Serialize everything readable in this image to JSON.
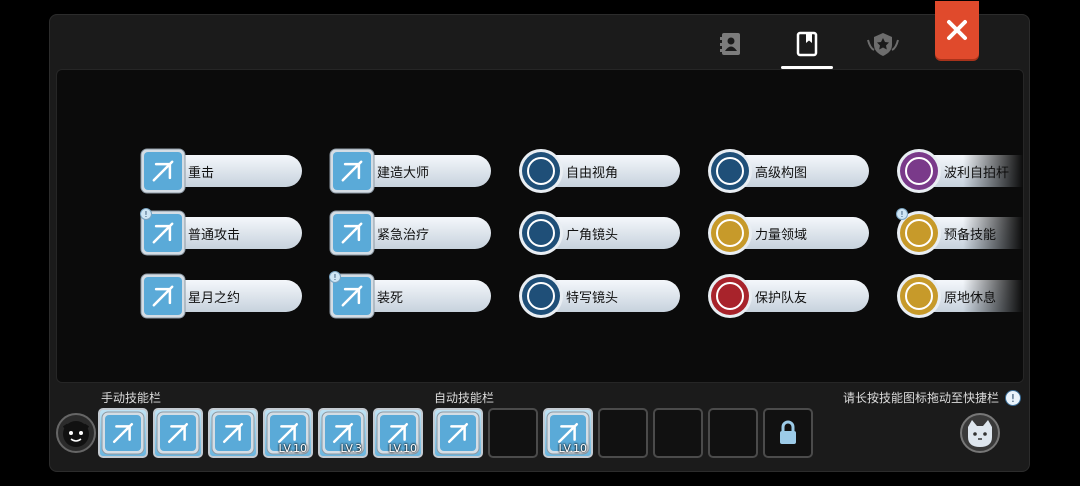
{
  "tabs": [
    {
      "icon": "contact-book-icon",
      "active": false
    },
    {
      "icon": "bookmark-book-icon",
      "active": true
    },
    {
      "icon": "star-badge-icon",
      "active": false
    }
  ],
  "close_icon": "close-icon",
  "skills": [
    {
      "label": "重击",
      "icon": "fist-icon",
      "style": "blue"
    },
    {
      "label": "建造大师",
      "icon": "house-build-icon",
      "style": "blue"
    },
    {
      "label": "自由视角",
      "icon": "eye-360-icon",
      "style": "dark-blue"
    },
    {
      "label": "高级构图",
      "icon": "camera-frame-icon",
      "style": "dark-blue"
    },
    {
      "label": "波利自拍杆",
      "icon": "selfie-stick-icon",
      "style": "purple"
    },
    {
      "label": "普通攻击",
      "icon": "sword-attack-icon",
      "style": "blue",
      "badge": "!"
    },
    {
      "label": "紧急治疗",
      "icon": "heal-icon",
      "style": "blue"
    },
    {
      "label": "广角镜头",
      "icon": "wide-lens-icon",
      "style": "dark-blue"
    },
    {
      "label": "力量领域",
      "icon": "power-field-icon",
      "style": "gold"
    },
    {
      "label": "预备技能",
      "icon": "ready-skill-icon",
      "style": "gold",
      "badge": "!"
    },
    {
      "label": "星月之约",
      "icon": "star-moon-icon",
      "style": "blue"
    },
    {
      "label": "装死",
      "icon": "play-dead-icon",
      "style": "blue",
      "badge": "!"
    },
    {
      "label": "特写镜头",
      "icon": "closeup-lens-icon",
      "style": "dark-blue"
    },
    {
      "label": "保护队友",
      "icon": "protect-ally-icon",
      "style": "red"
    },
    {
      "label": "原地休息",
      "icon": "rest-icon",
      "style": "gold"
    }
  ],
  "manual_bar": {
    "label": "手动技能栏",
    "slots": [
      {
        "icon": "sword-attack-icon",
        "level": ""
      },
      {
        "icon": "fist-icon",
        "level": ""
      },
      {
        "icon": "play-dead-icon",
        "level": ""
      },
      {
        "icon": "whirl-skill-icon",
        "level": "LV.10"
      },
      {
        "icon": "wave-skill-icon",
        "level": "LV.3"
      },
      {
        "icon": "lightning-skill-icon",
        "level": "LV.10"
      }
    ]
  },
  "auto_bar": {
    "label": "自动技能栏",
    "slots": [
      {
        "icon": "sword-attack-icon",
        "level": "",
        "filled": true
      },
      {
        "icon": "",
        "level": "",
        "filled": false
      },
      {
        "icon": "whirl-skill-icon",
        "level": "LV.10",
        "filled": true
      },
      {
        "icon": "",
        "level": "",
        "filled": false
      },
      {
        "icon": "",
        "level": "",
        "filled": false
      },
      {
        "icon": "",
        "level": "",
        "filled": false
      },
      {
        "icon": "lock-icon",
        "level": "",
        "filled": false,
        "locked": true
      }
    ]
  },
  "hint": "请长按技能图标拖动至快捷栏",
  "colors": {
    "accent_close": "#e04a2c",
    "blue": "#5aaad8",
    "dark-blue": "#1f4f78",
    "gold": "#c79a2a",
    "purple": "#7a3a8a",
    "red": "#a8232b"
  }
}
